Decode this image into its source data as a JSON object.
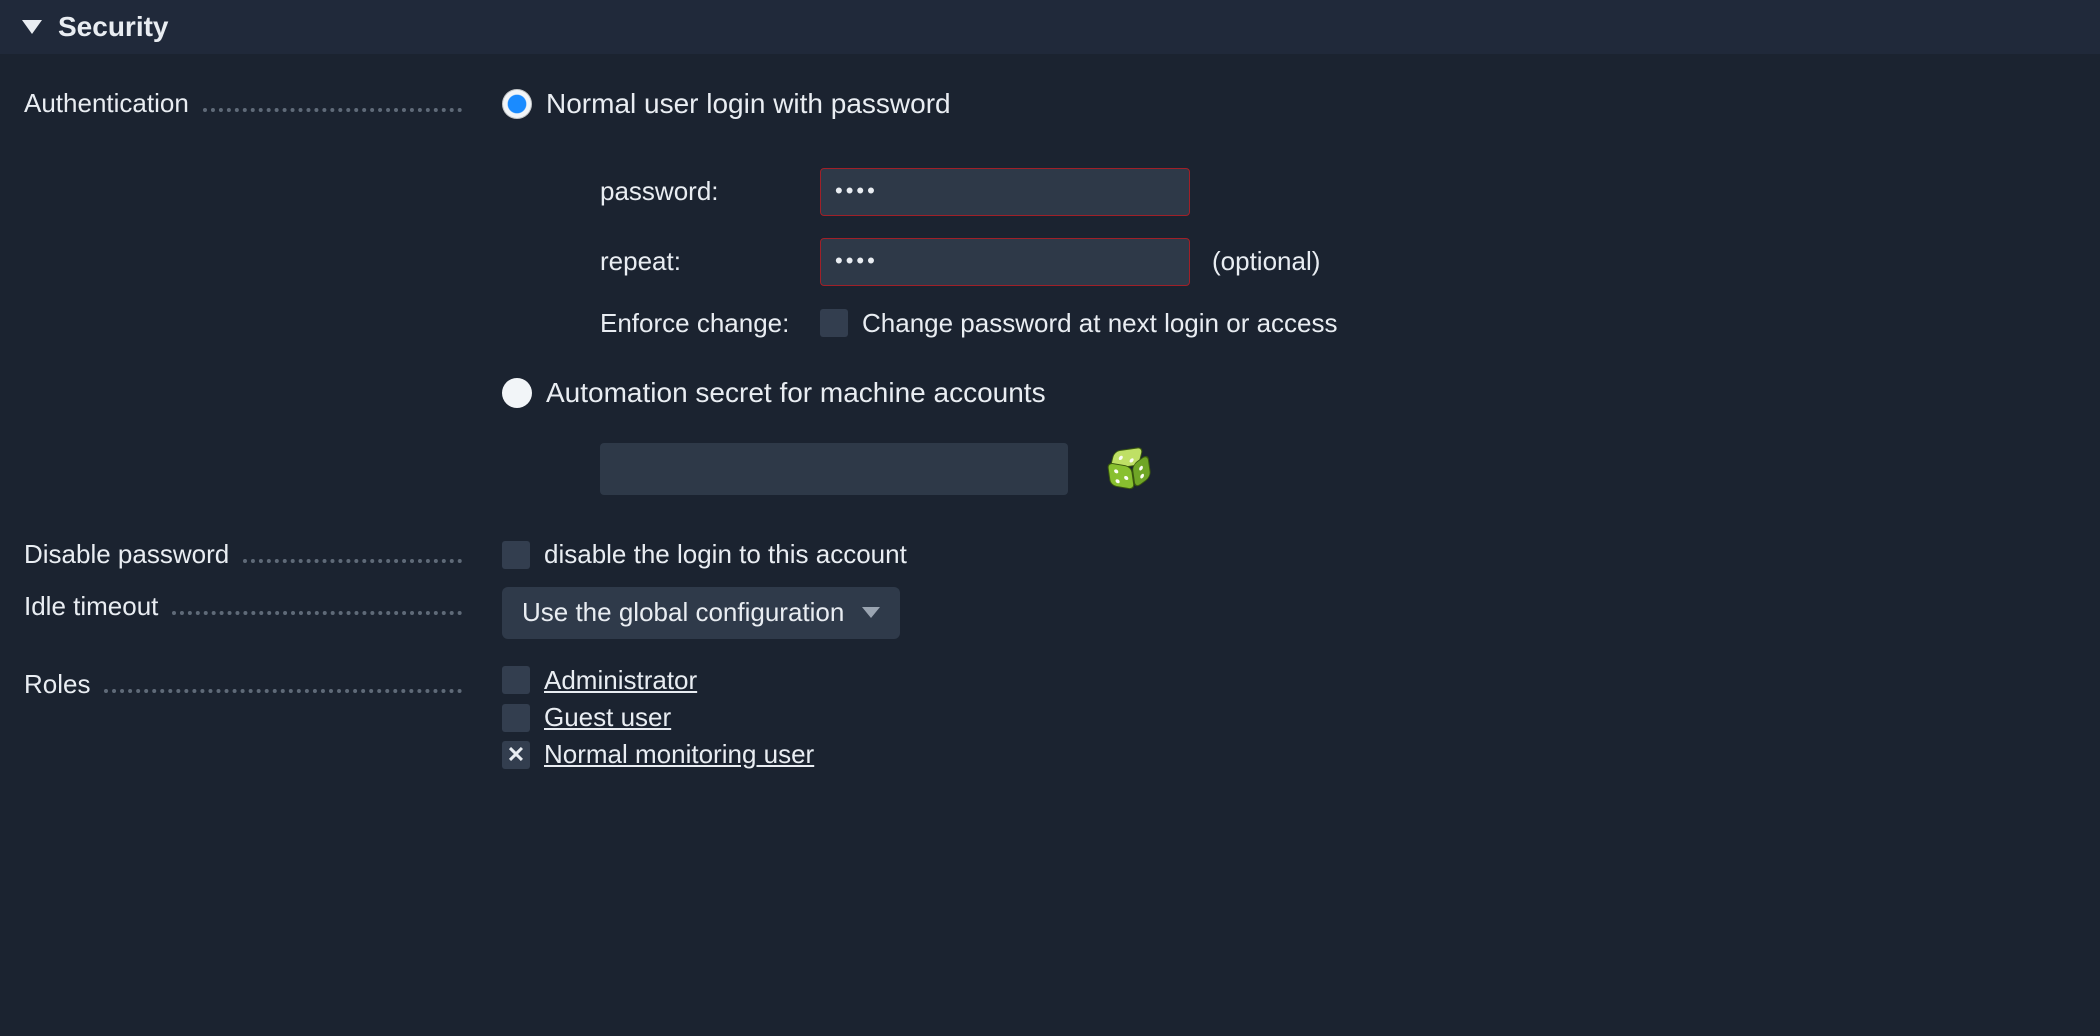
{
  "section": {
    "title": "Security"
  },
  "fields": {
    "authentication": {
      "label": "Authentication",
      "options": {
        "normal": {
          "label": "Normal user login with password",
          "checked": true
        },
        "automation": {
          "label": "Automation secret for machine accounts",
          "checked": false
        }
      },
      "password": {
        "label": "password:",
        "value": "••••"
      },
      "repeat": {
        "label": "repeat:",
        "value": "••••",
        "hint": "(optional)"
      },
      "enforce": {
        "label": "Enforce change:",
        "checkbox_label": "Change password at next login or access",
        "checked": false
      },
      "secret": {
        "value": ""
      }
    },
    "disable_password": {
      "label": "Disable password",
      "checkbox_label": "disable the login to this account",
      "checked": false
    },
    "idle_timeout": {
      "label": "Idle timeout",
      "selected": "Use the global configuration"
    },
    "roles": {
      "label": "Roles",
      "items": [
        {
          "label": "Administrator",
          "checked": false
        },
        {
          "label": "Guest user",
          "checked": false
        },
        {
          "label": "Normal monitoring user",
          "checked": true
        }
      ]
    }
  },
  "icons": {
    "dice": "dice-icon"
  }
}
